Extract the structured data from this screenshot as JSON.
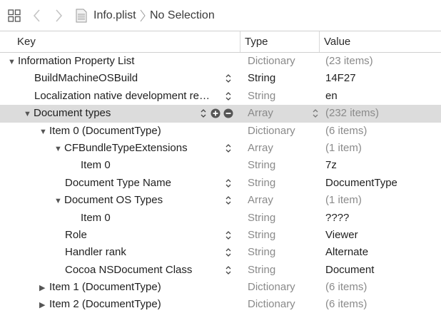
{
  "jumpbar": {
    "file_name": "Info.plist",
    "selection": "No Selection",
    "icons": [
      "related-items-grid-icon",
      "back-arrow-icon",
      "forward-arrow-icon",
      "plist-file-icon",
      "path-separator-icon"
    ]
  },
  "columns": {
    "key": "Key",
    "type": "Type",
    "value": "Value"
  },
  "rows": [
    {
      "key": "Information Property List",
      "type": "Dictionary",
      "value": "(23 items)"
    },
    {
      "key": "BuildMachineOSBuild",
      "type": "String",
      "value": "14F27"
    },
    {
      "key": "Localization native development re…",
      "type": "String",
      "value": "en"
    },
    {
      "key": "Document types",
      "type": "Array",
      "value": "(232 items)"
    },
    {
      "key": "Item 0 (DocumentType)",
      "type": "Dictionary",
      "value": "(6 items)"
    },
    {
      "key": "CFBundleTypeExtensions",
      "type": "Array",
      "value": "(1 item)"
    },
    {
      "key": "Item 0",
      "type": "String",
      "value": "7z"
    },
    {
      "key": "Document Type Name",
      "type": "String",
      "value": "DocumentType"
    },
    {
      "key": "Document OS Types",
      "type": "Array",
      "value": "(1 item)"
    },
    {
      "key": "Item 0",
      "type": "String",
      "value": "????"
    },
    {
      "key": "Role",
      "type": "String",
      "value": "Viewer"
    },
    {
      "key": "Handler rank",
      "type": "String",
      "value": "Alternate"
    },
    {
      "key": "Cocoa NSDocument Class",
      "type": "String",
      "value": "Document"
    },
    {
      "key": "Item 1 (DocumentType)",
      "type": "Dictionary",
      "value": "(6 items)"
    },
    {
      "key": "Item 2 (DocumentType)",
      "type": "Dictionary",
      "value": "(6 items)"
    }
  ]
}
